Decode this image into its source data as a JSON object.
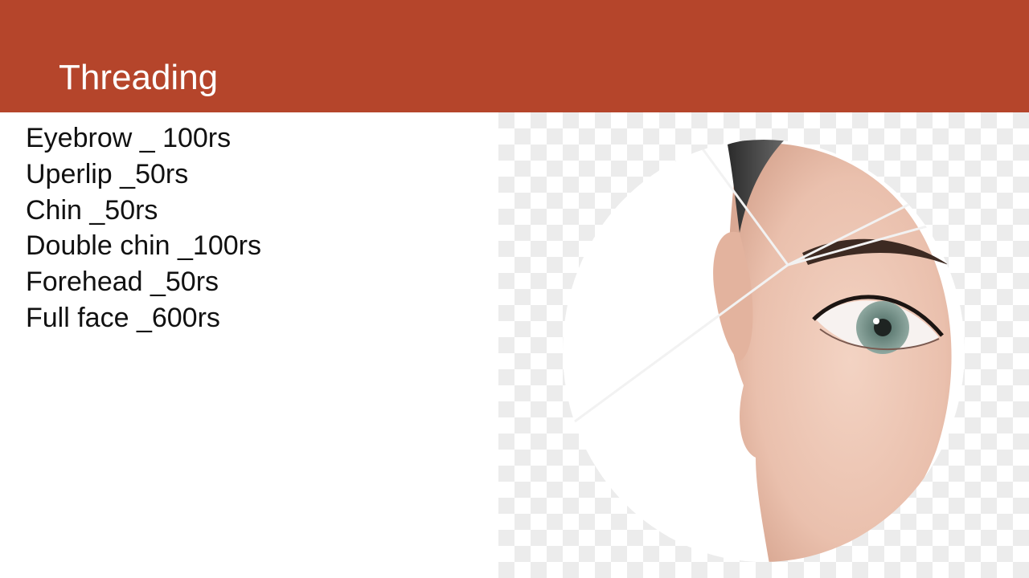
{
  "slide": {
    "title": "Threading",
    "items": [
      "Eyebrow _ 100rs",
      "Uperlip _50rs",
      "Chin _50rs",
      "Double chin _100rs",
      "Forehead _50rs",
      "Full face _600rs"
    ]
  },
  "colors": {
    "header": "#b5452b",
    "title_text": "#ffffff",
    "body_text": "#111111"
  },
  "image": {
    "icon": "eyebrow-threading-photo"
  }
}
